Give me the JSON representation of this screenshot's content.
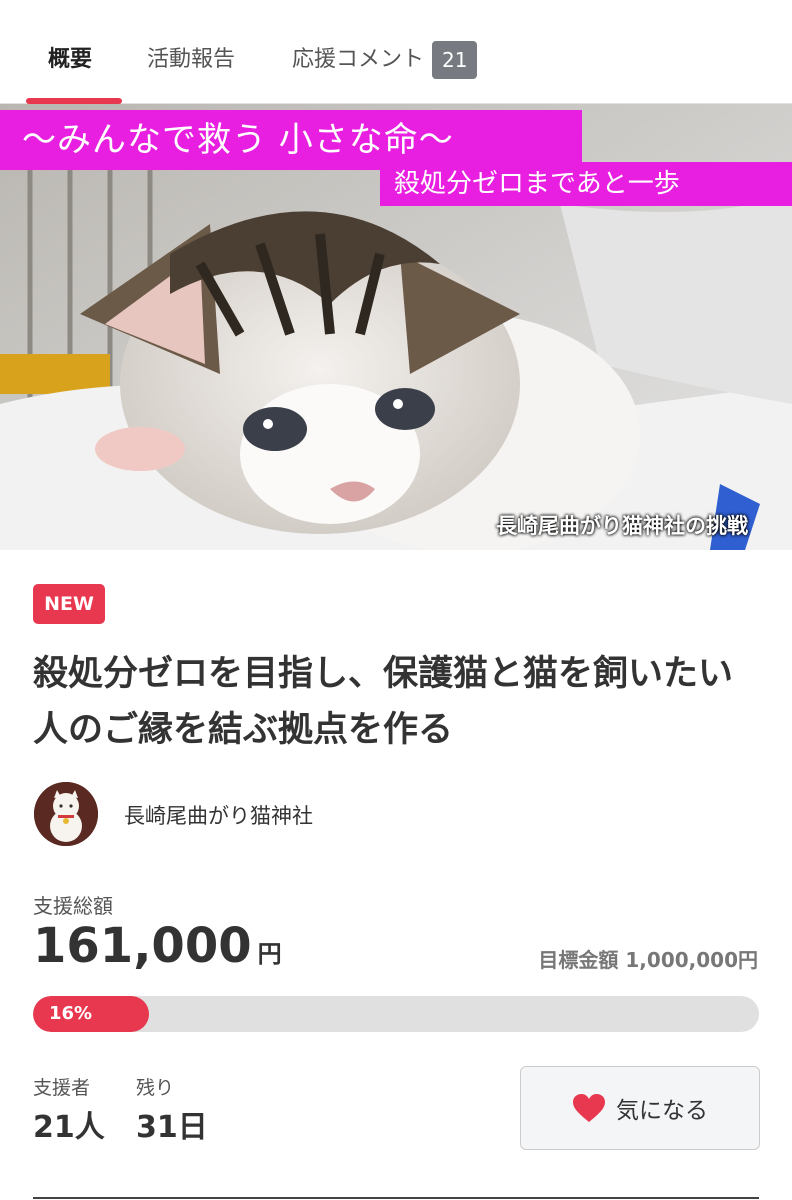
{
  "tabs": [
    {
      "label": "概要",
      "active": true
    },
    {
      "label": "活動報告",
      "active": false
    },
    {
      "label": "応援コメント",
      "count": "21",
      "active": false
    }
  ],
  "hero": {
    "banner_main": "～みんなで救う 小さな命～",
    "banner_sub": "殺処分ゼロまであと一歩",
    "caption": "長崎尾曲がり猫神社の挑戦"
  },
  "project": {
    "badge": "NEW",
    "title": "殺処分ゼロを目指し、保護猫と猫を飼いたい人のご縁を結ぶ拠点を作る",
    "owner": "長崎尾曲がり猫神社"
  },
  "funding": {
    "raised_label": "支援総額",
    "raised_amount": "161,000",
    "currency": "円",
    "goal_text": "目標金額 1,000,000円",
    "progress_percent": 16,
    "progress_label": "16%"
  },
  "stats": {
    "supporters_label": "支援者",
    "supporters_value": "21人",
    "remaining_label": "残り",
    "remaining_value": "31日"
  },
  "actions": {
    "favorite_label": "気になる",
    "favorite_icon": "heart-icon"
  },
  "colors": {
    "accent": "#e8384f",
    "banner": "#e81fe0"
  }
}
